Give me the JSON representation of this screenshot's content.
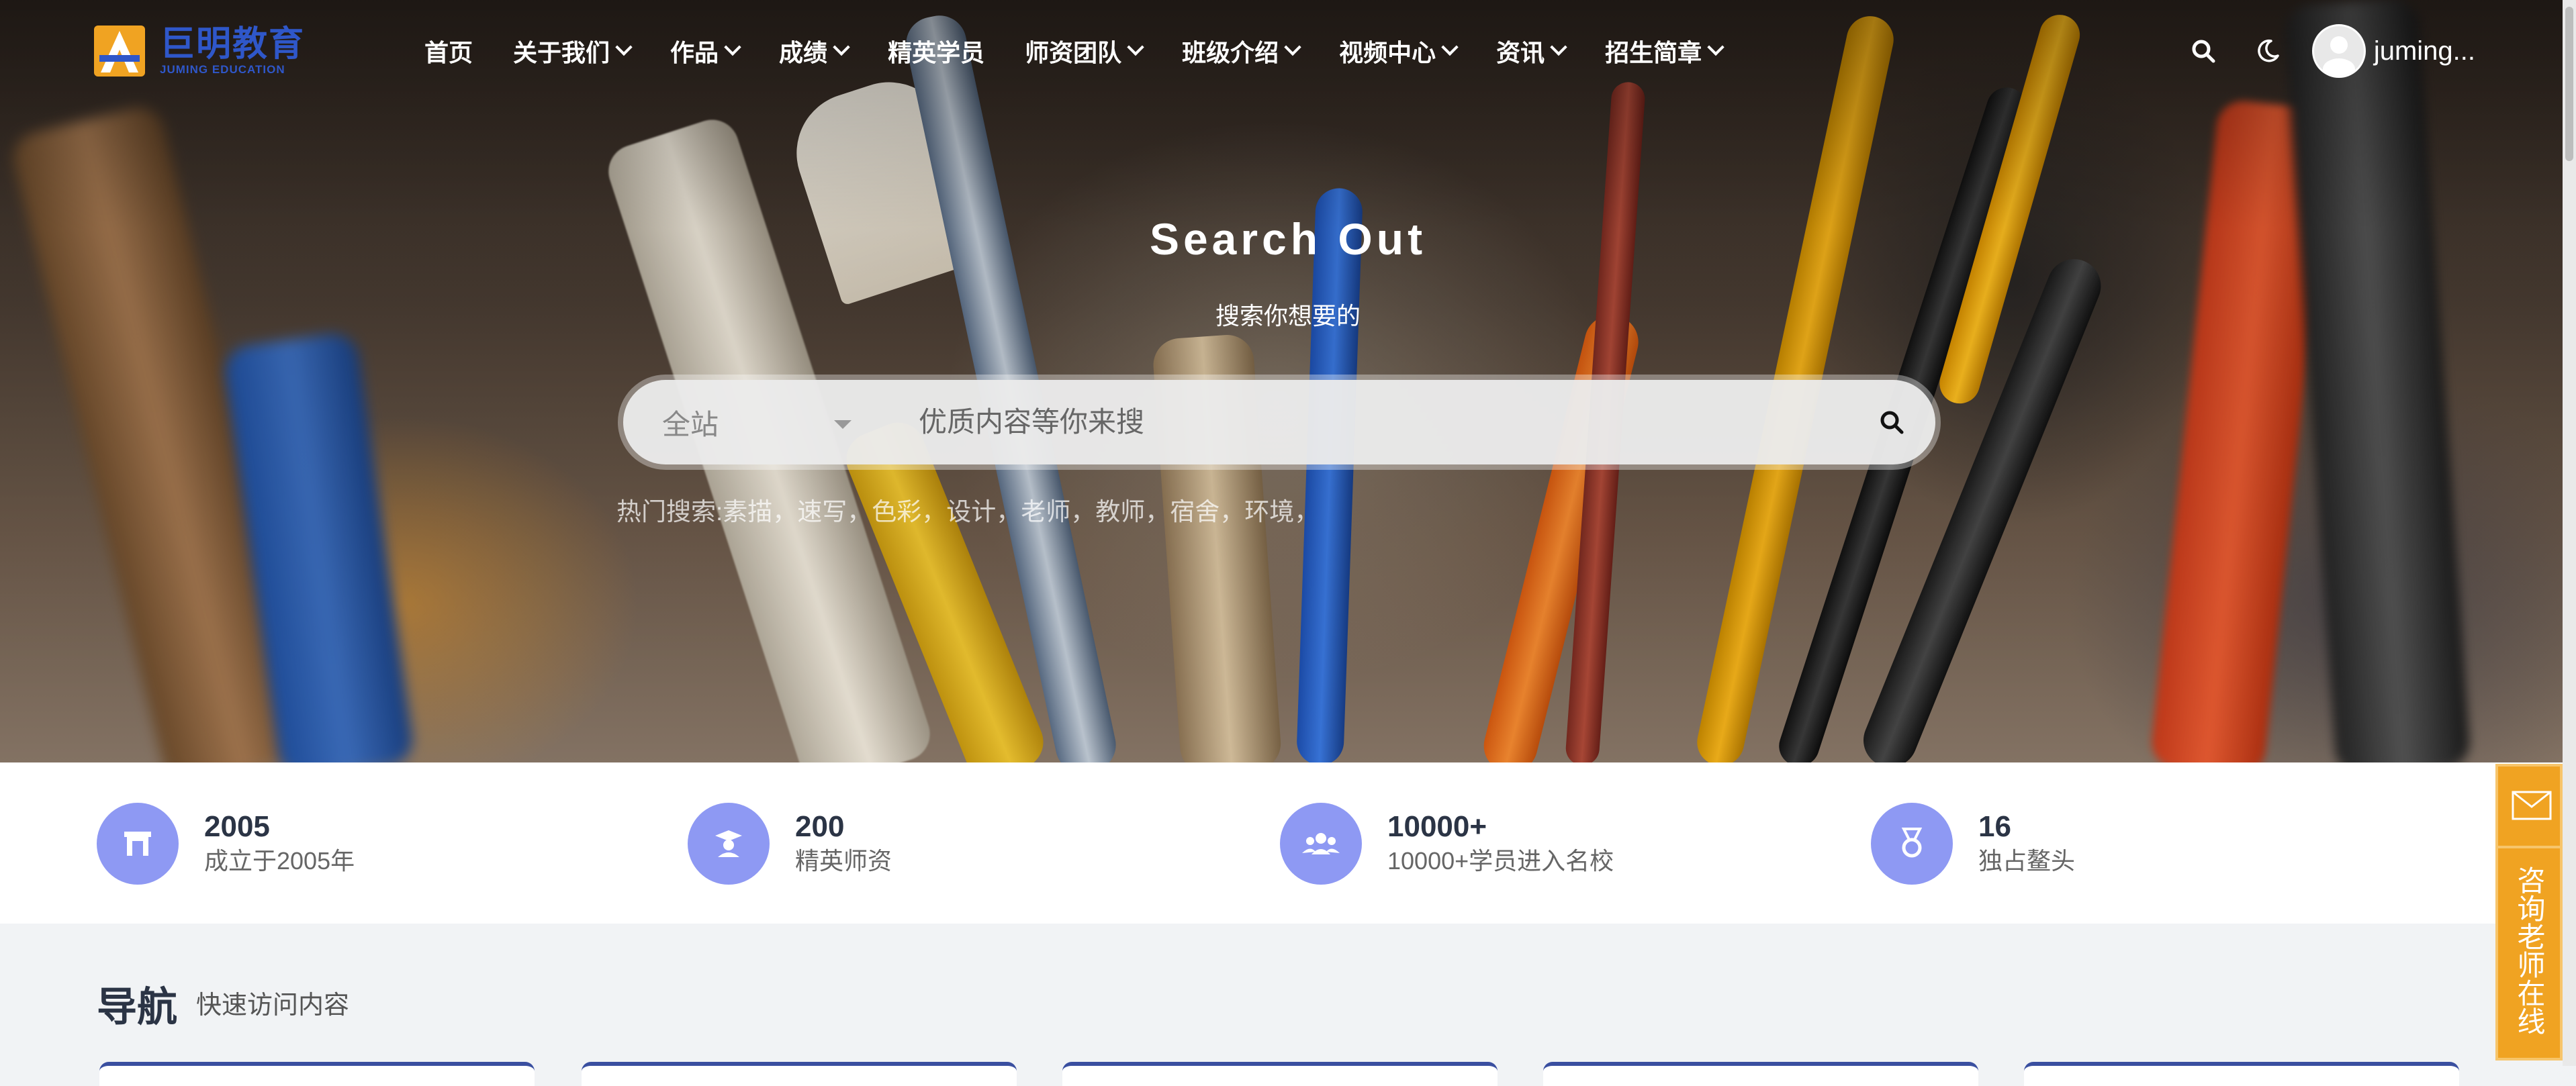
{
  "brand": {
    "name_cn": "巨明教育",
    "name_en": "JUMING EDUCATION",
    "color": "#2f57c9",
    "accent": "#f0a322"
  },
  "nav": {
    "items": [
      {
        "label": "首页",
        "dropdown": false
      },
      {
        "label": "关于我们",
        "dropdown": true
      },
      {
        "label": "作品",
        "dropdown": true
      },
      {
        "label": "成绩",
        "dropdown": true
      },
      {
        "label": "精英学员",
        "dropdown": false
      },
      {
        "label": "师资团队",
        "dropdown": true
      },
      {
        "label": "班级介绍",
        "dropdown": true
      },
      {
        "label": "视频中心",
        "dropdown": true
      },
      {
        "label": "资讯",
        "dropdown": true
      },
      {
        "label": "招生简章",
        "dropdown": true
      }
    ],
    "search_icon": "search-icon",
    "theme_icon": "moon-icon",
    "username": "juming..."
  },
  "hero": {
    "title": "Search Out",
    "subtitle": "搜索你想要的",
    "scope": "全站",
    "placeholder": "优质内容等你来搜",
    "hot_label": "热门搜索:",
    "hot_keywords": [
      "素描",
      "速写",
      "色彩",
      "设计",
      "老师",
      "教师",
      "宿舍",
      "环境"
    ]
  },
  "stats": [
    {
      "icon": "building-icon",
      "number": "2005",
      "label": "成立于2005年"
    },
    {
      "icon": "teacher-icon",
      "number": "200",
      "label": "精英师资"
    },
    {
      "icon": "students-icon",
      "number": "10000+",
      "label": "10000+学员进入名校"
    },
    {
      "icon": "medal-icon",
      "number": "16",
      "label": "独占鳌头"
    }
  ],
  "section": {
    "title": "导航",
    "subtitle": "快速访问内容"
  },
  "consult": {
    "icon": "mail-icon",
    "label": "咨询老师在线"
  }
}
